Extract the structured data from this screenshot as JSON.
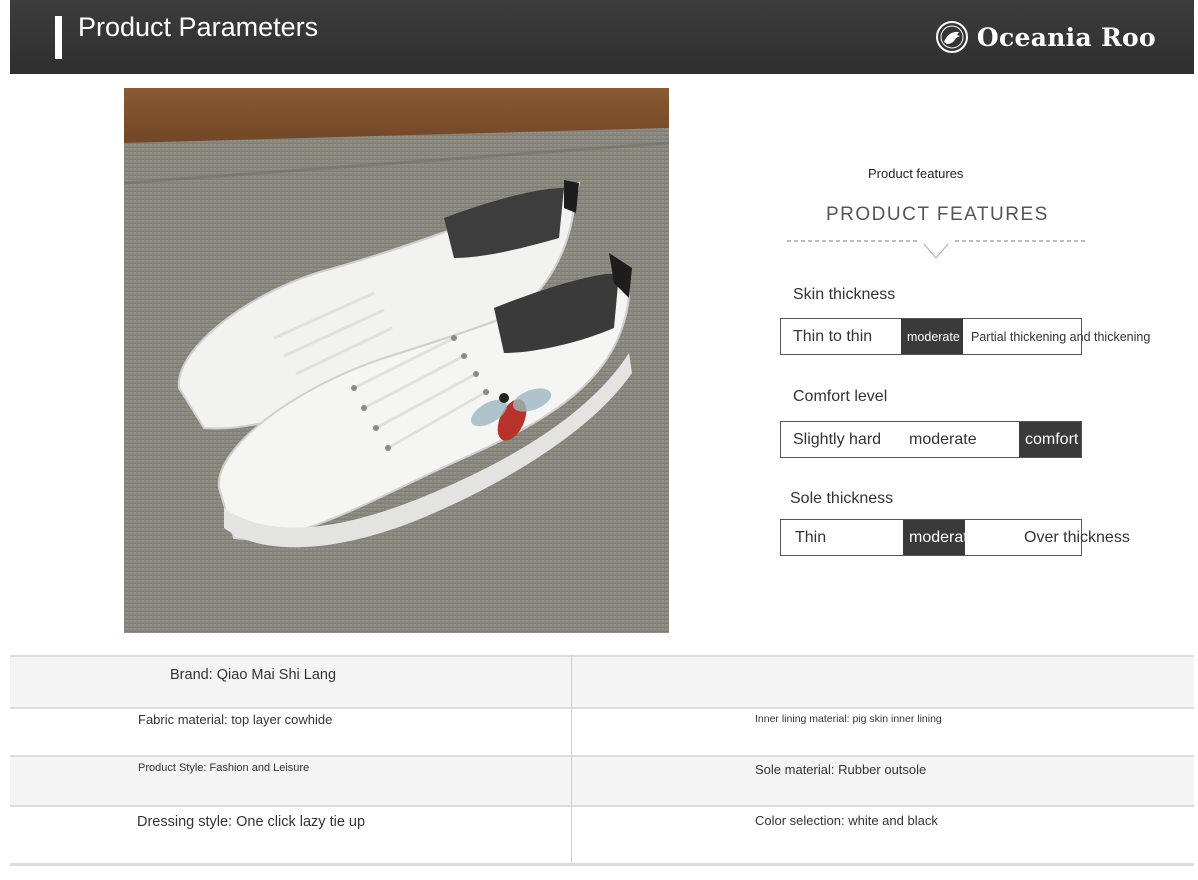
{
  "header": {
    "title": "Product Parameters",
    "brand": "Oceania Roo"
  },
  "features": {
    "subtitle": "Product features",
    "title": "PRODUCT FEATURES",
    "params": [
      {
        "label": "Skin thickness",
        "options": [
          "Thin to thin",
          "moderate",
          "Partial thickening and thickening"
        ],
        "selected": "moderate"
      },
      {
        "label": "Comfort level",
        "options": [
          "Slightly hard",
          "moderate",
          "comfort"
        ],
        "selected": "comfort"
      },
      {
        "label": "Sole thickness",
        "options": [
          "Thin",
          "moderate",
          "Over thickness"
        ],
        "selected": "moderate"
      }
    ]
  },
  "specs": {
    "brand": "Brand: Qiao Mai Shi Lang",
    "fabric": "Fabric material: top layer cowhide",
    "lining": "Inner lining material: pig skin inner lining",
    "style": "Product Style: Fashion and Leisure",
    "sole": "Sole material: Rubber outsole",
    "dressing": "Dressing style: One click lazy tie up",
    "color": "Color selection: white and black"
  },
  "colors": {
    "header_bg": "#333333",
    "active_cell": "#3a3a3a",
    "shoe": "#f2f2f0"
  },
  "icons": {
    "logo": "kangaroo-globe-icon"
  }
}
